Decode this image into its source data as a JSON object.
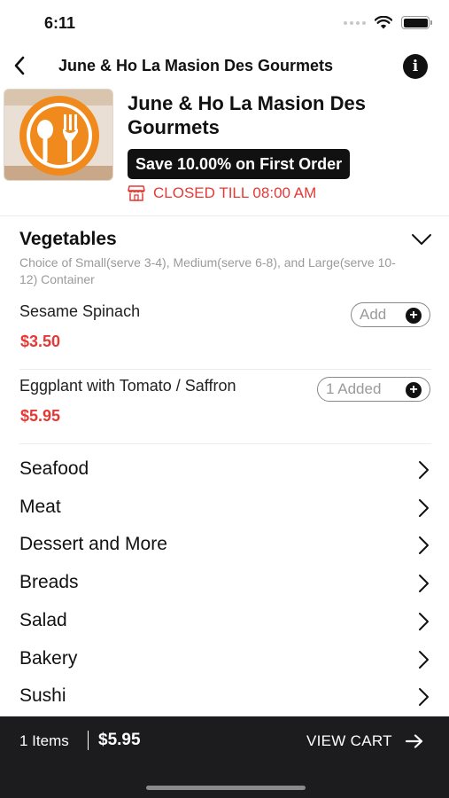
{
  "status_bar": {
    "time": "6:11"
  },
  "nav": {
    "title": "June & Ho La Masion Des Gourmets"
  },
  "restaurant": {
    "name": "June & Ho La Masion Des Gourmets",
    "promo": "Save 10.00% on First Order",
    "status": "CLOSED TILL 08:00 AM"
  },
  "colors": {
    "accent_red": "#e53935",
    "logo_orange": "#f08a1c",
    "dark": "#111111",
    "cart_bar": "#1c1c1e"
  },
  "expanded_category": {
    "title": "Vegetables",
    "description": "Choice of Small(serve 3-4), Medium(serve 6-8), and Large(serve 10-12) Container",
    "items": [
      {
        "name": "Sesame Spinach",
        "price": "$3.50",
        "button": "Add"
      },
      {
        "name": "Eggplant with Tomato / Saffron",
        "price": "$5.95",
        "button": "1 Added"
      }
    ]
  },
  "categories": [
    {
      "label": "Seafood"
    },
    {
      "label": "Meat"
    },
    {
      "label": "Dessert and More"
    },
    {
      "label": "Breads"
    },
    {
      "label": "Salad"
    },
    {
      "label": "Bakery"
    },
    {
      "label": "Sushi"
    }
  ],
  "cart": {
    "count": "1 Items",
    "total": "$5.95",
    "action": "VIEW CART"
  },
  "icons": {
    "back": "chevron-left-icon",
    "info": "info-icon",
    "store": "store-icon",
    "expand": "chevron-down-icon",
    "row": "chevron-right-icon",
    "add": "plus-circle-icon",
    "cart_action": "arrow-right-icon"
  }
}
